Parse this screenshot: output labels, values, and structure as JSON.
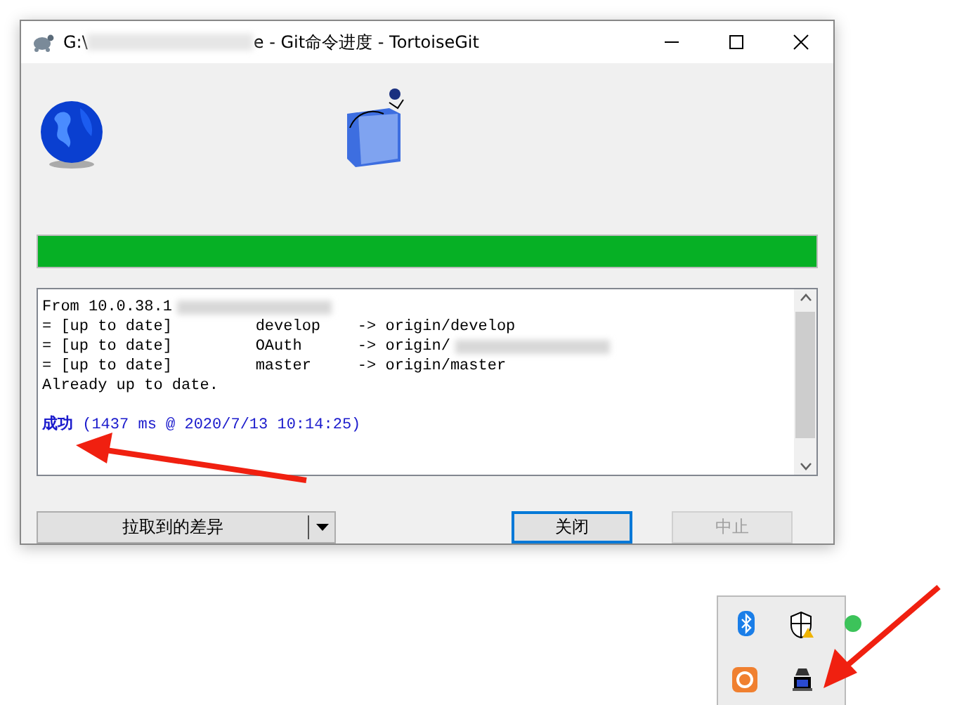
{
  "window": {
    "title_start": "G:\\",
    "title_end": "e - Git命令进度 - TortoiseGit"
  },
  "progress": {
    "level": 1
  },
  "log": {
    "lines": [
      {
        "text": "From 10.0.38.1",
        "kind": "redacted"
      },
      {
        "text": "= [up to date]         develop    -> origin/develop",
        "kind": "plain"
      },
      {
        "text": "= [up to date]         OAuth      -> origin/",
        "kind": "redacted"
      },
      {
        "text": "= [up to date]         master     -> origin/master",
        "kind": "plain"
      },
      {
        "text": "Already up to date.",
        "kind": "plain"
      }
    ],
    "result": {
      "status": "成功",
      "detail": "(1437 ms @ 2020/7/13 10:14:25)"
    }
  },
  "buttons": [
    {
      "label": "拉取到的差异",
      "kind": "split",
      "default": false,
      "disabled": false
    },
    {
      "label": "关闭",
      "kind": "push",
      "default": true,
      "disabled": false
    },
    {
      "label": "中止",
      "kind": "push",
      "default": false,
      "disabled": true
    }
  ]
}
